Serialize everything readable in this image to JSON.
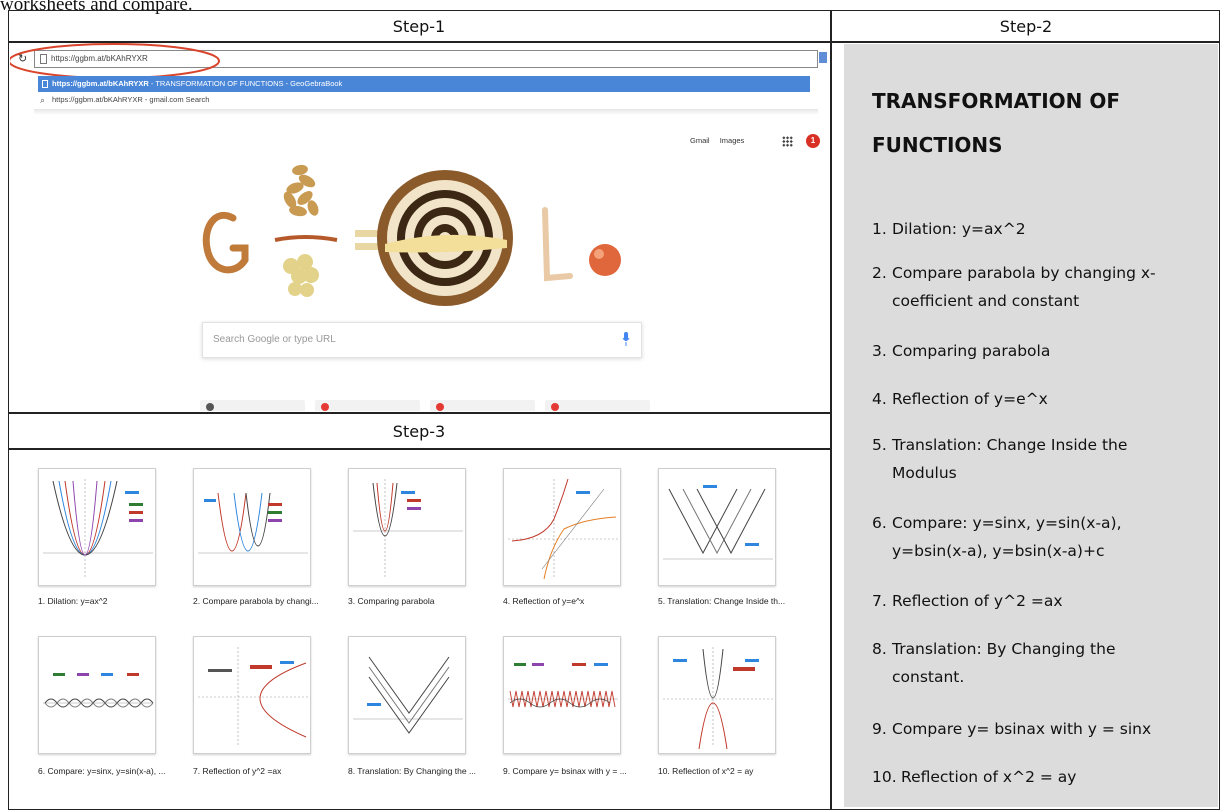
{
  "caption_fragment": "worksheets and compare.",
  "steps": {
    "step1": "Step-1",
    "step2": "Step-2",
    "step3": "Step-3"
  },
  "browser": {
    "omnibox_value": "https://ggbm.at/bKAhRYXR",
    "suggestion_selected_url": "https://ggbm.at/bKAhRYXR",
    "suggestion_selected_title": " - TRANSFORMATION OF FUNCTIONS - GeoGebraBook",
    "suggestion_other": "https://ggbm.at/bKAhRYXR - gmail.com Search",
    "link_gmail": "Gmail",
    "link_images": "Images",
    "notification_count": "1",
    "search_placeholder": "Search Google or type URL",
    "annotation_color": "#d9442c",
    "selected_color": "#4a86d8"
  },
  "step2_list": {
    "title_line1": "TRANSFORMATION OF",
    "title_line2": "FUNCTIONS",
    "items": [
      {
        "num": "1.",
        "lines": [
          "Dilation: y=ax^2"
        ]
      },
      {
        "num": "2.",
        "lines": [
          "Compare parabola by changing x-",
          "coefficient and constant"
        ]
      },
      {
        "num": "3.",
        "lines": [
          "Comparing parabola"
        ]
      },
      {
        "num": "4.",
        "lines": [
          "Reflection of y=e^x"
        ]
      },
      {
        "num": "5.",
        "lines": [
          "Translation: Change Inside the",
          "Modulus"
        ]
      },
      {
        "num": "6.",
        "lines": [
          "Compare: y=sinx, y=sin(x-a),",
          "y=bsin(x-a), y=bsin(x-a)+c"
        ]
      },
      {
        "num": "7.",
        "lines": [
          "Reflection of y^2 =ax"
        ]
      },
      {
        "num": "8.",
        "lines": [
          "Translation: By Changing the",
          "constant."
        ]
      },
      {
        "num": "9.",
        "lines": [
          "Compare y= bsinax with y = sinx"
        ]
      },
      {
        "num": "10.",
        "lines": [
          "Reflection of x^2 = ay"
        ]
      }
    ]
  },
  "step3_cards": [
    {
      "caption": "1. Dilation: y=ax^2",
      "icon": "parabola-dilation-thumbnail"
    },
    {
      "caption": "2. Compare parabola by changi...",
      "icon": "parabola-compare-thumbnail"
    },
    {
      "caption": "3. Comparing parabola",
      "icon": "parabola-thumbnail"
    },
    {
      "caption": "4. Reflection of y=e^x",
      "icon": "exponential-reflection-thumbnail"
    },
    {
      "caption": "5. Translation: Change Inside th...",
      "icon": "modulus-translation-thumbnail"
    },
    {
      "caption": "6. Compare: y=sinx, y=sin(x-a), ...",
      "icon": "sine-compare-thumbnail"
    },
    {
      "caption": "7. Reflection of y^2 =ax",
      "icon": "parabola-sideways-thumbnail"
    },
    {
      "caption": "8. Translation: By Changing the ...",
      "icon": "modulus-constant-thumbnail"
    },
    {
      "caption": "9. Compare y= bsinax with y = ...",
      "icon": "sine-frequency-thumbnail"
    },
    {
      "caption": "10. Reflection of x^2 = ay",
      "icon": "parabola-reflection-thumbnail"
    }
  ]
}
